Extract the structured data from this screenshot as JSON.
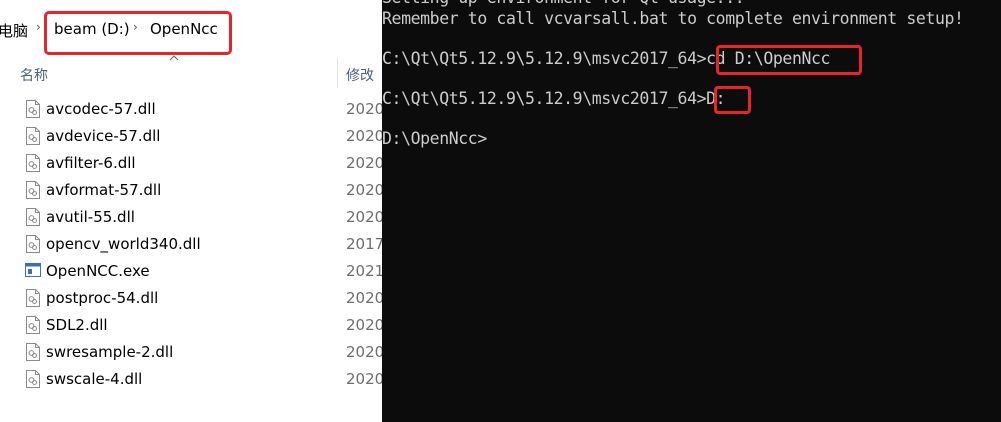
{
  "explorer": {
    "breadcrumb": [
      {
        "label": "电脑"
      },
      {
        "label": "beam (D:)"
      },
      {
        "label": "OpenNcc"
      }
    ],
    "columns": {
      "name": "名称",
      "modified": "修改"
    },
    "files": [
      {
        "name": "avcodec-57.dll",
        "date": "2020",
        "icon": "dll-file-icon"
      },
      {
        "name": "avdevice-57.dll",
        "date": "2020",
        "icon": "dll-file-icon"
      },
      {
        "name": "avfilter-6.dll",
        "date": "2020",
        "icon": "dll-file-icon"
      },
      {
        "name": "avformat-57.dll",
        "date": "2020",
        "icon": "dll-file-icon"
      },
      {
        "name": "avutil-55.dll",
        "date": "2020",
        "icon": "dll-file-icon"
      },
      {
        "name": "opencv_world340.dll",
        "date": "2017",
        "icon": "dll-file-icon"
      },
      {
        "name": "OpenNCC.exe",
        "date": "2021",
        "icon": "exe-file-icon"
      },
      {
        "name": "postproc-54.dll",
        "date": "2020",
        "icon": "dll-file-icon"
      },
      {
        "name": "SDL2.dll",
        "date": "2020",
        "icon": "dll-file-icon"
      },
      {
        "name": "swresample-2.dll",
        "date": "2020",
        "icon": "dll-file-icon"
      },
      {
        "name": "swscale-4.dll",
        "date": "2020",
        "icon": "dll-file-icon"
      }
    ]
  },
  "terminal": {
    "lines": [
      "Setting up environment for Qt usage...",
      "Remember to call vcvarsall.bat to complete environment setup!",
      "",
      "C:\\Qt\\Qt5.12.9\\5.12.9\\msvc2017_64>cd D:\\OpenNcc",
      "",
      "C:\\Qt\\Qt5.12.9\\5.12.9\\msvc2017_64>D:",
      "",
      "D:\\OpenNcc>"
    ]
  },
  "colors": {
    "highlight": "#e8232a",
    "terminal_bg": "#0c0c0c",
    "terminal_fg": "#cccccc"
  }
}
